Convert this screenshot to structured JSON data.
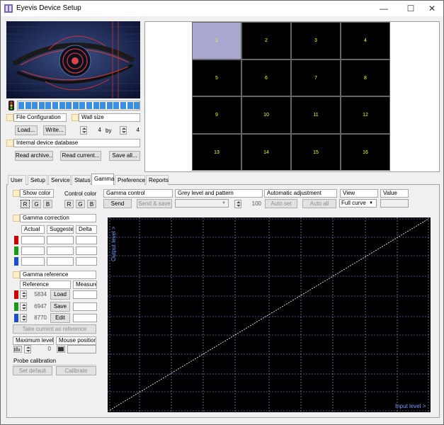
{
  "window": {
    "title": "Eyevis Device Setup",
    "minimize": "—",
    "maximize": "☐",
    "close": "✕"
  },
  "top_left": {
    "file_configuration": "File Configuration",
    "wall_size": "Wall size",
    "load_btn": "Load...",
    "write_btn": "Write...",
    "wall_cols": "4",
    "by_label": "by",
    "wall_rows": "4",
    "internal_db": "Internal device database",
    "read_archive_btn": "Read archive...",
    "read_current_btn": "Read current...",
    "save_all_btn": "Save all..."
  },
  "wall_grid": [
    "1",
    "2",
    "3",
    "4",
    "5",
    "6",
    "7",
    "8",
    "9",
    "10",
    "11",
    "12",
    "13",
    "14",
    "15",
    "16"
  ],
  "tabs": [
    "User",
    "Setup",
    "Service",
    "Status",
    "Gamma",
    "Preference",
    "Reports"
  ],
  "active_tab": "Gamma",
  "gamma": {
    "show_color": "Show color",
    "show_color_buttons": [
      "R",
      "G",
      "B"
    ],
    "control_color": "Control color",
    "control_color_buttons": [
      "R",
      "G",
      "B"
    ],
    "gamma_control": "Gamma control",
    "send_btn": "Send",
    "send_save_btn": "Send & save",
    "grey_level_pattern": "Grey level  and pattern",
    "grey_value": "100",
    "automatic_adjustment": "Automatic adjustment",
    "auto_set_btn": "Auto set",
    "auto_all_btn": "Auto all",
    "view_label": "View",
    "view_value": "Full curve",
    "value_label": "Value",
    "gamma_correction": "Gamma correction",
    "col_actual": "Actual",
    "col_suggested": "Suggested",
    "col_delta": "Delta",
    "gamma_reference": "Gamma reference",
    "reference_label": "Reference",
    "measure_label": "Measure",
    "ref_values": [
      "5834",
      "6947",
      "8770"
    ],
    "ref_buttons": [
      "Load",
      "Save",
      "Edit"
    ],
    "take_current_btn": "Take current as reference",
    "maximum_level": "Maximum level",
    "max_value": "0",
    "mouse_position": "Mouse position",
    "probe_calibration": "Probe calibration",
    "set_default_btn": "Set default",
    "calibrate_btn": "Calibrate",
    "colors": {
      "red": "#cc0000",
      "green": "#1a9a1a",
      "blue": "#1a4fd0",
      "check": "#fdf0c8"
    }
  },
  "chart_data": {
    "type": "line",
    "xlabel": "Input level >",
    "ylabel": "Output level >",
    "x": [
      0,
      1
    ],
    "series": [
      {
        "values": [
          0,
          1
        ]
      }
    ],
    "xlim": [
      0,
      1
    ],
    "ylim": [
      0,
      1
    ],
    "grid": true
  }
}
